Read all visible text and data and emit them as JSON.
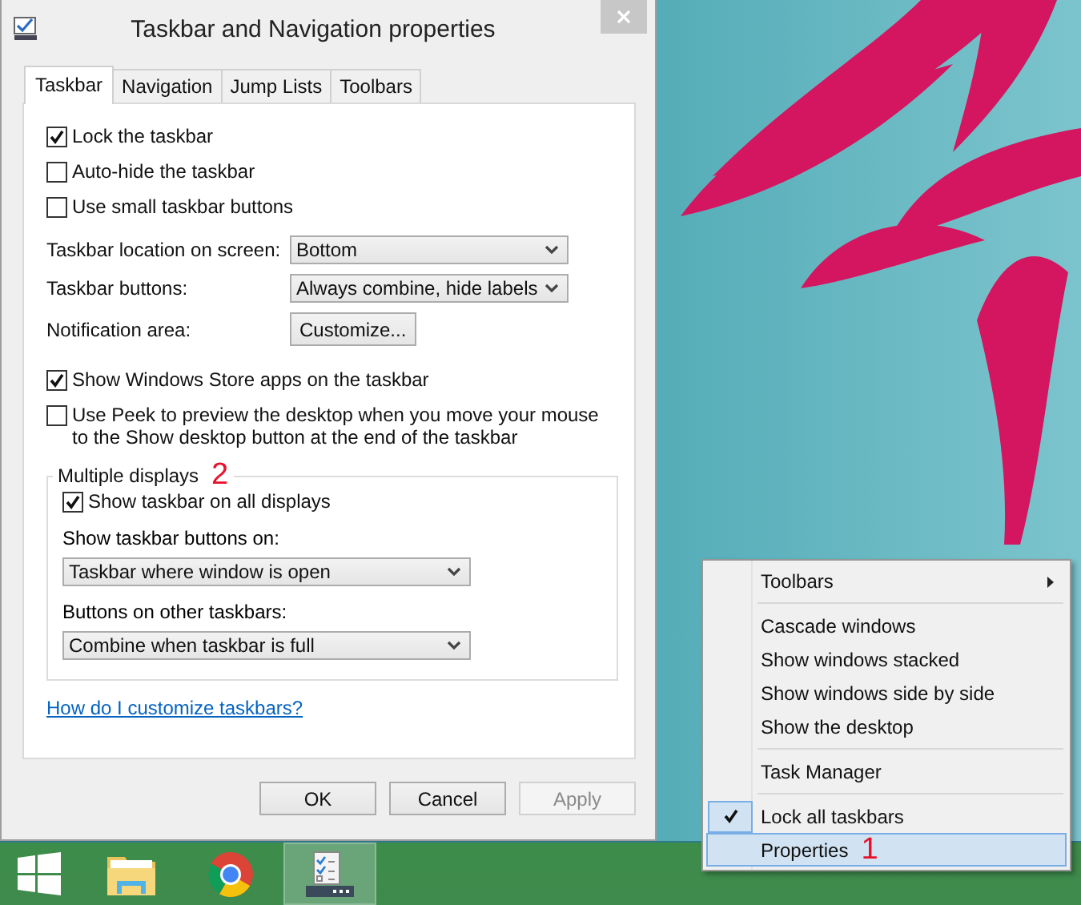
{
  "dialog": {
    "title": "Taskbar and Navigation properties",
    "tabs": [
      {
        "label": "Taskbar",
        "selected": true
      },
      {
        "label": "Navigation",
        "selected": false
      },
      {
        "label": "Jump Lists",
        "selected": false
      },
      {
        "label": "Toolbars",
        "selected": false
      }
    ],
    "options_top": [
      {
        "label": "Lock the taskbar",
        "checked": true
      },
      {
        "label": "Auto-hide the taskbar",
        "checked": false
      },
      {
        "label": "Use small taskbar buttons",
        "checked": false
      }
    ],
    "settings": [
      {
        "label": "Taskbar location on screen:",
        "kind": "dropdown",
        "value": "Bottom"
      },
      {
        "label": "Taskbar buttons:",
        "kind": "dropdown",
        "value": "Always combine, hide labels"
      },
      {
        "label": "Notification area:",
        "kind": "button",
        "value": "Customize..."
      }
    ],
    "options_bottom": [
      {
        "label": "Show Windows Store apps on the taskbar",
        "checked": true
      },
      {
        "label": "Use Peek to preview the desktop when you move your mouse to the Show desktop button at the end of the taskbar",
        "checked": false
      }
    ],
    "multiple_displays": {
      "title": "Multiple displays",
      "annotation": "2",
      "option": {
        "label": "Show taskbar on all displays",
        "checked": true
      },
      "fields": [
        {
          "label": "Show taskbar buttons on:",
          "value": "Taskbar where window is open"
        },
        {
          "label": "Buttons on other taskbars:",
          "value": "Combine when taskbar is full"
        }
      ]
    },
    "help_link": "How do I customize taskbars?",
    "buttons": [
      {
        "label": "OK",
        "disabled": false
      },
      {
        "label": "Cancel",
        "disabled": false
      },
      {
        "label": "Apply",
        "disabled": true
      }
    ]
  },
  "context_menu": {
    "groups": [
      [
        {
          "label": "Toolbars",
          "submenu": true,
          "checked": false,
          "selected": false
        }
      ],
      [
        {
          "label": "Cascade windows",
          "submenu": false,
          "checked": false,
          "selected": false
        },
        {
          "label": "Show windows stacked",
          "submenu": false,
          "checked": false,
          "selected": false
        },
        {
          "label": "Show windows side by side",
          "submenu": false,
          "checked": false,
          "selected": false
        },
        {
          "label": "Show the desktop",
          "submenu": false,
          "checked": false,
          "selected": false
        }
      ],
      [
        {
          "label": "Task Manager",
          "submenu": false,
          "checked": false,
          "selected": false
        }
      ],
      [
        {
          "label": "Lock all taskbars",
          "submenu": false,
          "checked": true,
          "selected": false
        },
        {
          "label": "Properties",
          "submenu": false,
          "checked": false,
          "selected": true,
          "annotation": "1"
        }
      ]
    ]
  },
  "taskbar": {
    "apps": [
      {
        "kind": "start",
        "selected": false
      },
      {
        "kind": "folder",
        "selected": false
      },
      {
        "kind": "browser",
        "selected": false
      },
      {
        "kind": "checklist",
        "selected": true
      }
    ]
  }
}
